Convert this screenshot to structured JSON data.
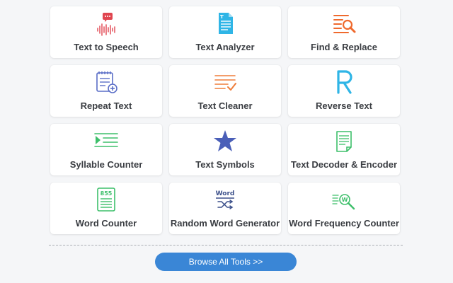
{
  "tools": [
    {
      "label": "Text to Speech",
      "icon": "text-to-speech-icon",
      "color": "#e0454f"
    },
    {
      "label": "Text Analyzer",
      "icon": "text-analyzer-icon",
      "color": "#2fb5e6"
    },
    {
      "label": "Find & Replace",
      "icon": "find-replace-icon",
      "color": "#ef6a2e"
    },
    {
      "label": "Repeat Text",
      "icon": "repeat-text-icon",
      "color": "#5a6ec7"
    },
    {
      "label": "Text Cleaner",
      "icon": "text-cleaner-icon",
      "color": "#ef7d3a"
    },
    {
      "label": "Reverse Text",
      "icon": "reverse-text-icon",
      "color": "#2fb5e6"
    },
    {
      "label": "Syllable Counter",
      "icon": "syllable-counter-icon",
      "color": "#3dbf6a"
    },
    {
      "label": "Text Symbols",
      "icon": "star-icon",
      "color": "#4a5fb8"
    },
    {
      "label": "Text Decoder & Encoder",
      "icon": "decoder-encoder-icon",
      "color": "#3dbf6a"
    },
    {
      "label": "Word Counter",
      "icon": "word-counter-icon",
      "color": "#3dbf6a"
    },
    {
      "label": "Random Word Generator",
      "icon": "random-word-icon",
      "color": "#3b4f8a"
    },
    {
      "label": "Word Frequency Counter",
      "icon": "word-frequency-icon",
      "color": "#3dbf6a"
    }
  ],
  "word_counter_number": "855",
  "random_word_text": "Word",
  "frequency_letter": "W",
  "browse_button": "Browse All Tools >>"
}
